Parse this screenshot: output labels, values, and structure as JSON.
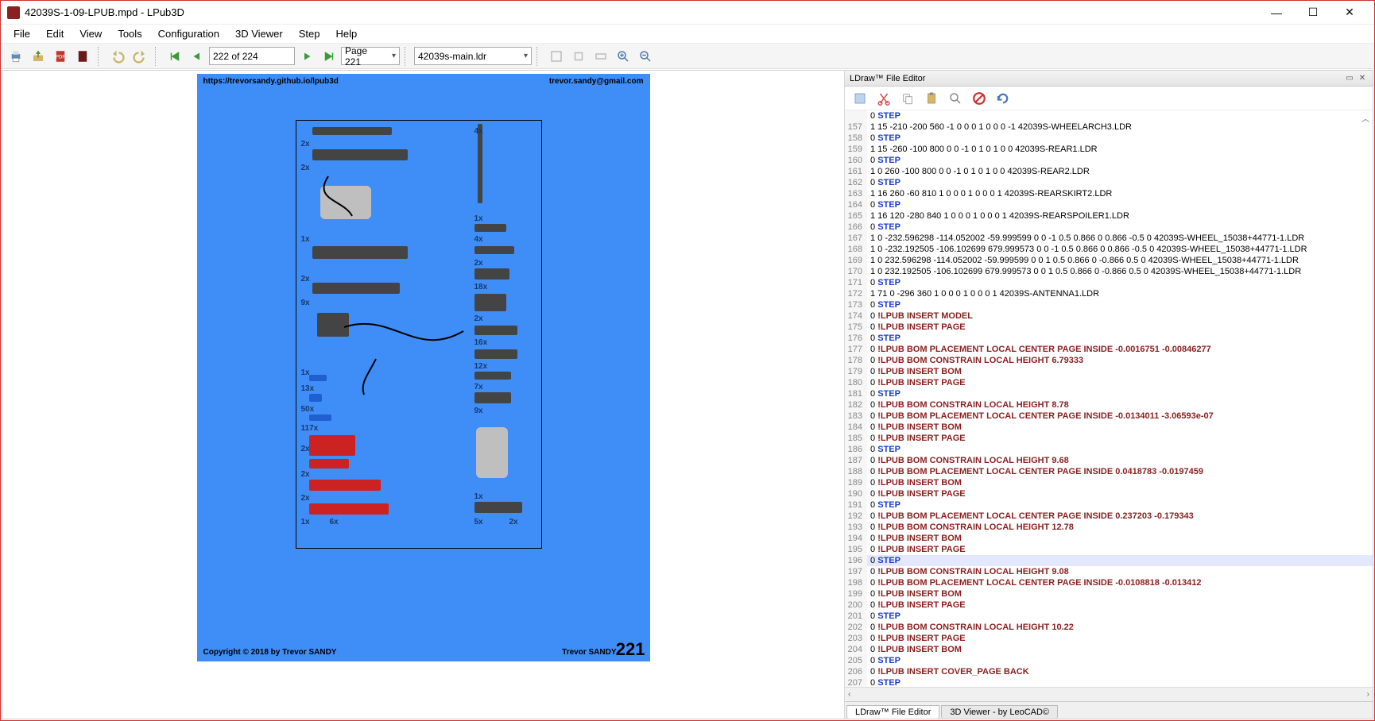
{
  "title": "42039S-1-09-LPUB.mpd - LPub3D",
  "menu": [
    "File",
    "Edit",
    "View",
    "Tools",
    "Configuration",
    "3D Viewer",
    "Step",
    "Help"
  ],
  "toolbar": {
    "page_counter": "222 of 224",
    "page_combo": "Page 221",
    "file_combo": "42039s-main.ldr"
  },
  "page": {
    "top_left": "https://trevorsandy.github.io/lpub3d",
    "top_right": "trevor.sandy@gmail.com",
    "bot_left": "Copyright © 2018 by Trevor SANDY",
    "bot_right": "Trevor SANDY",
    "page_num": "221",
    "bom_labels": [
      "2x",
      "2x",
      "1x",
      "2x",
      "9x",
      "1x",
      "13x",
      "50x",
      "117x",
      "2x",
      "2x",
      "2x",
      "1x",
      "6x",
      "4x",
      "1x",
      "4x",
      "2x",
      "18x",
      "2x",
      "16x",
      "12x",
      "7x",
      "9x",
      "1x",
      "5x",
      "2x"
    ]
  },
  "editor": {
    "dock_title": "LDraw™ File Editor",
    "tabs": [
      "LDraw™ File Editor",
      "3D Viewer - by LeoCAD©"
    ],
    "highlight_line": 196,
    "lines": [
      {
        "n": "",
        "t": "0 STEP",
        "cls": "step"
      },
      {
        "n": 157,
        "t": "1 15 -210 -200 560 -1 0 0 0 1 0 0 0 -1 42039S-WHEELARCH3.LDR",
        "cls": "data"
      },
      {
        "n": 158,
        "t": "0 STEP",
        "cls": "step"
      },
      {
        "n": 159,
        "t": "1 15 -260 -100 800 0 0 -1 0 1 0 1 0 0 42039S-REAR1.LDR",
        "cls": "data"
      },
      {
        "n": 160,
        "t": "0 STEP",
        "cls": "step"
      },
      {
        "n": 161,
        "t": "1 0 260 -100 800 0 0 -1 0 1 0 1 0 0 42039S-REAR2.LDR",
        "cls": "data"
      },
      {
        "n": 162,
        "t": "0 STEP",
        "cls": "step"
      },
      {
        "n": 163,
        "t": "1 16 260 -60 810 1 0 0 0 1 0 0 0 1 42039S-REARSKIRT2.LDR",
        "cls": "data"
      },
      {
        "n": 164,
        "t": "0 STEP",
        "cls": "step"
      },
      {
        "n": 165,
        "t": "1 16 120 -280 840 1 0 0 0 1 0 0 0 1 42039S-REARSPOILER1.LDR",
        "cls": "data"
      },
      {
        "n": 166,
        "t": "0 STEP",
        "cls": "step"
      },
      {
        "n": 167,
        "t": "1 0 -232.596298 -114.052002 -59.999599 0 0 -1 0.5 0.866 0 0.866 -0.5 0 42039S-WHEEL_15038+44771-1.LDR",
        "cls": "data"
      },
      {
        "n": 168,
        "t": "1 0 -232.192505 -106.102699 679.999573 0 0 -1 0.5 0.866 0 0.866 -0.5 0 42039S-WHEEL_15038+44771-1.LDR",
        "cls": "data"
      },
      {
        "n": 169,
        "t": "1 0 232.596298 -114.052002 -59.999599 0 0 1 0.5 0.866 0 -0.866 0.5 0 42039S-WHEEL_15038+44771-1.LDR",
        "cls": "data"
      },
      {
        "n": 170,
        "t": "1 0 232.192505 -106.102699 679.999573 0 0 1 0.5 0.866 0 -0.866 0.5 0 42039S-WHEEL_15038+44771-1.LDR",
        "cls": "data"
      },
      {
        "n": 171,
        "t": "0 STEP",
        "cls": "step"
      },
      {
        "n": 172,
        "t": "1 71 0 -296 360 1 0 0 0 1 0 0 0 1 42039S-ANTENNA1.LDR",
        "cls": "data"
      },
      {
        "n": 173,
        "t": "0 STEP",
        "cls": "step"
      },
      {
        "n": 174,
        "t": "0 !LPUB INSERT MODEL",
        "cls": "lpub"
      },
      {
        "n": 175,
        "t": "0 !LPUB INSERT PAGE",
        "cls": "lpub"
      },
      {
        "n": 176,
        "t": "0 STEP",
        "cls": "step"
      },
      {
        "n": 177,
        "t": "0 !LPUB BOM PLACEMENT LOCAL CENTER PAGE INSIDE -0.0016751 -0.00846277",
        "cls": "lpub"
      },
      {
        "n": 178,
        "t": "0 !LPUB BOM CONSTRAIN LOCAL HEIGHT 6.79333",
        "cls": "lpub"
      },
      {
        "n": 179,
        "t": "0 !LPUB INSERT BOM",
        "cls": "lpub"
      },
      {
        "n": 180,
        "t": "0 !LPUB INSERT PAGE",
        "cls": "lpub"
      },
      {
        "n": 181,
        "t": "0 STEP",
        "cls": "step"
      },
      {
        "n": 182,
        "t": "0 !LPUB BOM CONSTRAIN LOCAL HEIGHT 8.78",
        "cls": "lpub"
      },
      {
        "n": 183,
        "t": "0 !LPUB BOM PLACEMENT LOCAL CENTER PAGE INSIDE -0.0134011 -3.06593e-07",
        "cls": "lpub"
      },
      {
        "n": 184,
        "t": "0 !LPUB INSERT BOM",
        "cls": "lpub"
      },
      {
        "n": 185,
        "t": "0 !LPUB INSERT PAGE",
        "cls": "lpub"
      },
      {
        "n": 186,
        "t": "0 STEP",
        "cls": "step"
      },
      {
        "n": 187,
        "t": "0 !LPUB BOM CONSTRAIN LOCAL HEIGHT 9.68",
        "cls": "lpub"
      },
      {
        "n": 188,
        "t": "0 !LPUB BOM PLACEMENT LOCAL CENTER PAGE INSIDE 0.0418783 -0.0197459",
        "cls": "lpub"
      },
      {
        "n": 189,
        "t": "0 !LPUB INSERT BOM",
        "cls": "lpub"
      },
      {
        "n": 190,
        "t": "0 !LPUB INSERT PAGE",
        "cls": "lpub"
      },
      {
        "n": 191,
        "t": "0 STEP",
        "cls": "step"
      },
      {
        "n": 192,
        "t": "0 !LPUB BOM PLACEMENT LOCAL CENTER PAGE INSIDE 0.237203 -0.179343",
        "cls": "lpub"
      },
      {
        "n": 193,
        "t": "0 !LPUB BOM CONSTRAIN LOCAL HEIGHT 12.78",
        "cls": "lpub"
      },
      {
        "n": 194,
        "t": "0 !LPUB INSERT BOM",
        "cls": "lpub"
      },
      {
        "n": 195,
        "t": "0 !LPUB INSERT PAGE",
        "cls": "lpub"
      },
      {
        "n": 196,
        "t": "0 STEP",
        "cls": "step"
      },
      {
        "n": 197,
        "t": "0 !LPUB BOM CONSTRAIN LOCAL HEIGHT 9.08",
        "cls": "lpub"
      },
      {
        "n": 198,
        "t": "0 !LPUB BOM PLACEMENT LOCAL CENTER PAGE INSIDE -0.0108818 -0.013412",
        "cls": "lpub"
      },
      {
        "n": 199,
        "t": "0 !LPUB INSERT BOM",
        "cls": "lpub"
      },
      {
        "n": 200,
        "t": "0 !LPUB INSERT PAGE",
        "cls": "lpub"
      },
      {
        "n": 201,
        "t": "0 STEP",
        "cls": "step"
      },
      {
        "n": 202,
        "t": "0 !LPUB BOM CONSTRAIN LOCAL HEIGHT 10.22",
        "cls": "lpub"
      },
      {
        "n": 203,
        "t": "0 !LPUB INSERT PAGE",
        "cls": "lpub"
      },
      {
        "n": 204,
        "t": "0 !LPUB INSERT BOM",
        "cls": "lpub"
      },
      {
        "n": 205,
        "t": "0 STEP",
        "cls": "step"
      },
      {
        "n": 206,
        "t": "0 !LPUB INSERT COVER_PAGE BACK",
        "cls": "lpub"
      },
      {
        "n": 207,
        "t": "0 STEP",
        "cls": "step"
      }
    ]
  }
}
